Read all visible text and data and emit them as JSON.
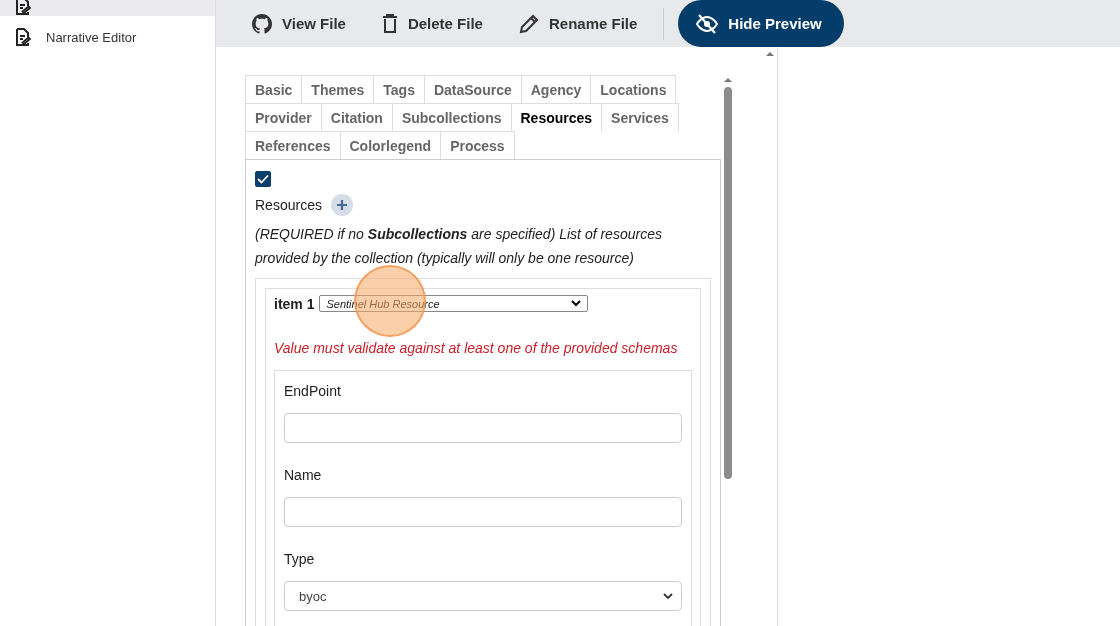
{
  "sidebar": {
    "items": [
      {
        "selected": true
      },
      {
        "label": "Narrative Editor",
        "selected": false
      }
    ]
  },
  "toolbar": {
    "buttons": [
      {
        "label": "View File",
        "primary": false
      },
      {
        "label": "Delete File",
        "primary": false
      },
      {
        "label": "Rename File",
        "primary": false
      },
      {
        "label": "Hide Preview",
        "primary": true
      }
    ]
  },
  "tabs": [
    {
      "label": "Basic",
      "selected": false
    },
    {
      "label": "Themes",
      "selected": false
    },
    {
      "label": "Tags",
      "selected": false
    },
    {
      "label": "DataSource",
      "selected": false
    },
    {
      "label": "Agency",
      "selected": false
    },
    {
      "label": "Locations",
      "selected": false
    },
    {
      "label": "Provider",
      "selected": false
    },
    {
      "label": "Citation",
      "selected": false
    },
    {
      "label": "Subcollections",
      "selected": false
    },
    {
      "label": "Resources",
      "selected": true
    },
    {
      "label": "Services",
      "selected": false
    },
    {
      "label": "References",
      "selected": false
    },
    {
      "label": "Colorlegend",
      "selected": false
    },
    {
      "label": "Process",
      "selected": false
    }
  ],
  "form": {
    "checked": true,
    "label": "Resources",
    "description": "(REQUIRED if no **Subcollections** are specified) List of resources provided by the collection (typically will only be one resource)",
    "item": {
      "label": "item 1",
      "schema": "Sentinel Hub Resource",
      "error": "Value must validate against at least one of the provided schemas",
      "fields": [
        {
          "label": "EndPoint",
          "kind": "text"
        },
        {
          "label": "Name",
          "kind": "text"
        },
        {
          "label": "Type",
          "kind": "select",
          "value": "byoc"
        }
      ]
    }
  }
}
